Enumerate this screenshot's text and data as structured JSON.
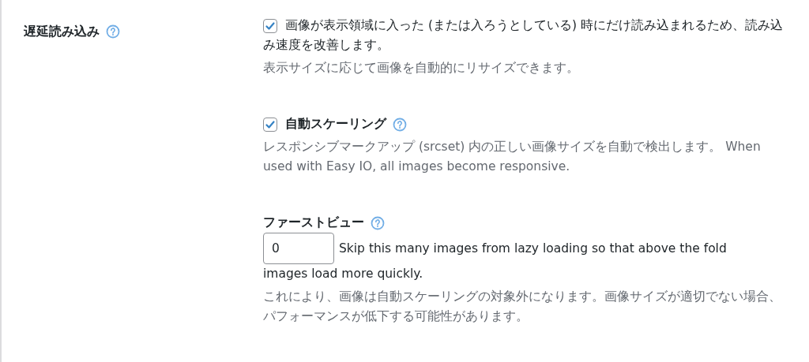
{
  "setting": {
    "label": "遅延読み込み",
    "help": true
  },
  "options": [
    {
      "kind": "checkbox",
      "checked": true,
      "label": "画像が表示領域に入った (または入ろうとしている) 時にだけ読み込まれるため、読み込み速度を改善します。",
      "description": "表示サイズに応じて画像を自動的にリサイズできます。"
    },
    {
      "kind": "checkbox-heading",
      "checked": true,
      "label": "自動スケーリング",
      "help": true,
      "description": "レスポンシブマークアップ (srcset) 内の正しい画像サイズを自動で検出します。 When used with Easy IO, all images become responsive."
    },
    {
      "kind": "number",
      "label": "ファーストビュー",
      "help": true,
      "value": "0",
      "text_lines": [
        "Skip this many images from lazy loading so that above the fold",
        "images load more quickly."
      ],
      "description": "これにより、画像は自動スケーリングの対象外になります。画像サイズが適切でない場合、パフォーマンスが低下する可能性があります。"
    }
  ]
}
